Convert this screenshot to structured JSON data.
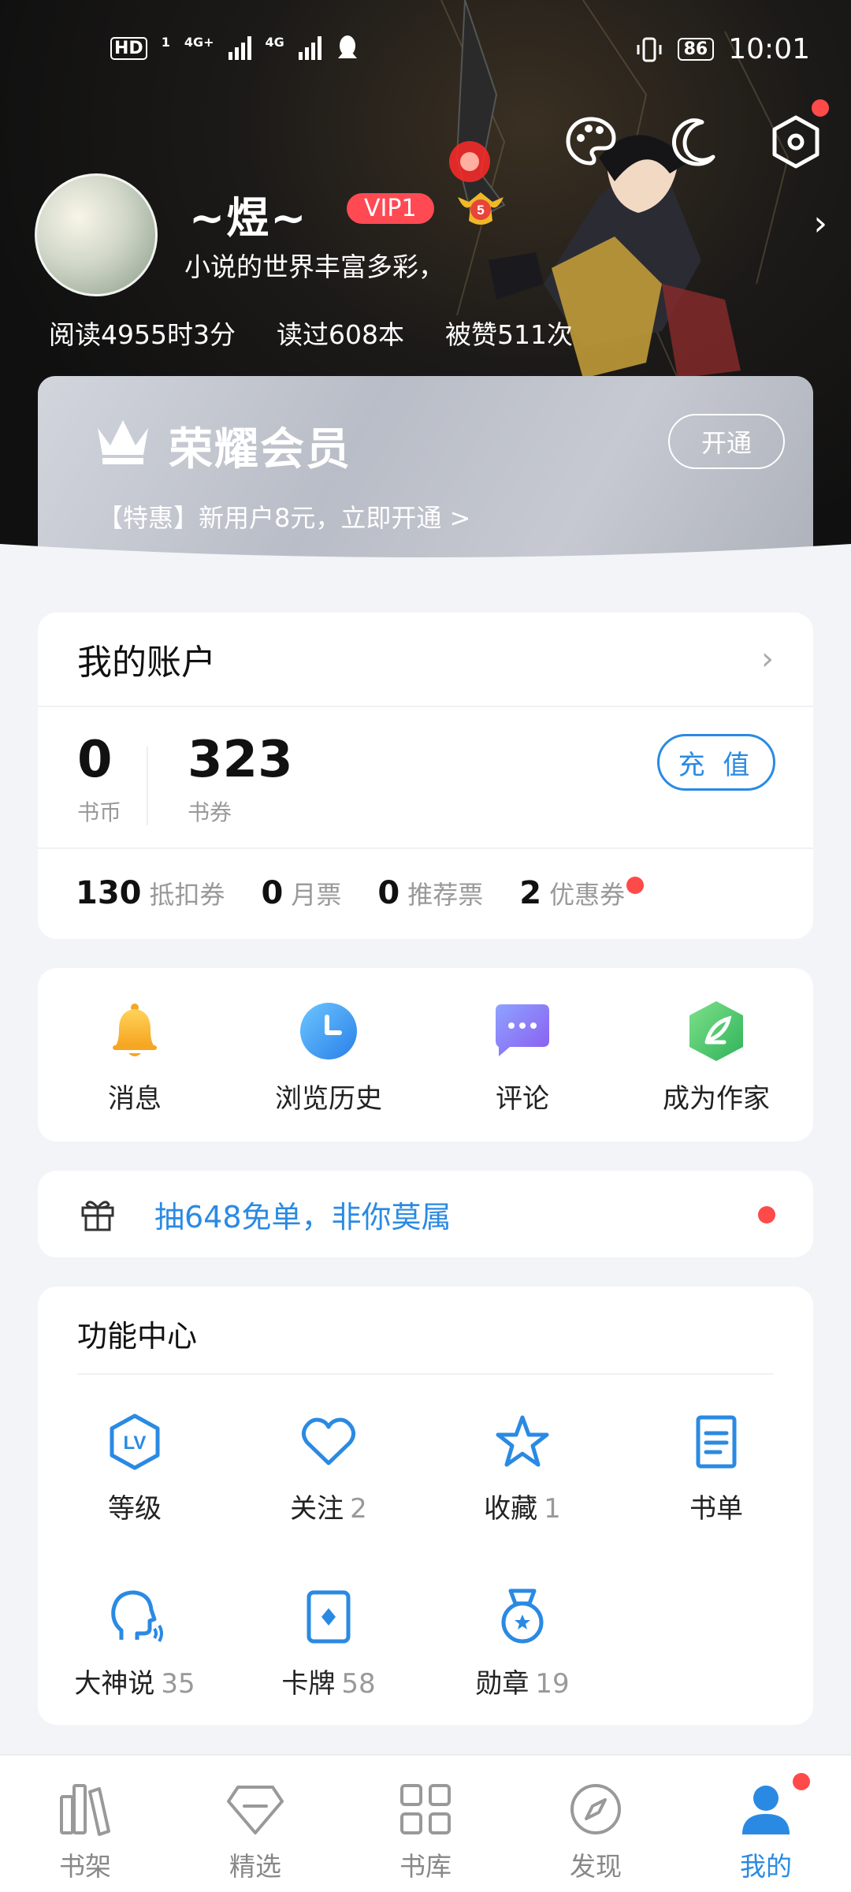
{
  "status_bar": {
    "hd": "HD",
    "sim1": "1",
    "net1": "4G+",
    "net2": "4G",
    "battery": "86",
    "time": "10:01"
  },
  "profile": {
    "username": "~煜~",
    "vip_badge": "VIP1",
    "level": "5",
    "bio": "小说的世界丰富多彩，",
    "stats": [
      "阅读4955时3分",
      "读过608本",
      "被赞511次"
    ]
  },
  "vip_card": {
    "title": "荣耀会员",
    "open_label": "开通",
    "promo": "【特惠】新用户8元，立即开通 >"
  },
  "account": {
    "title": "我的账户",
    "coins": {
      "value": "0",
      "label": "书币"
    },
    "vouchers": {
      "value": "323",
      "label": "书券"
    },
    "recharge_label": "充 值",
    "tickets": [
      {
        "value": "130",
        "label": "抵扣券"
      },
      {
        "value": "0",
        "label": "月票"
      },
      {
        "value": "0",
        "label": "推荐票"
      },
      {
        "value": "2",
        "label": "优惠券"
      }
    ]
  },
  "quick_actions": [
    {
      "label": "消息",
      "icon": "bell-icon"
    },
    {
      "label": "浏览历史",
      "icon": "clock-icon"
    },
    {
      "label": "评论",
      "icon": "chat-icon"
    },
    {
      "label": "成为作家",
      "icon": "feather-icon"
    }
  ],
  "promo_banner": {
    "text": "抽648免单，非你莫属"
  },
  "function_center": {
    "title": "功能中心",
    "items": [
      {
        "label": "等级",
        "count": "",
        "icon": "level-icon"
      },
      {
        "label": "关注",
        "count": "2",
        "icon": "heart-icon"
      },
      {
        "label": "收藏",
        "count": "1",
        "icon": "star-icon"
      },
      {
        "label": "书单",
        "count": "",
        "icon": "booklist-icon"
      },
      {
        "label": "大神说",
        "count": "35",
        "icon": "speaker-icon"
      },
      {
        "label": "卡牌",
        "count": "58",
        "icon": "card-icon"
      },
      {
        "label": "勋章",
        "count": "19",
        "icon": "medal-icon"
      }
    ]
  },
  "tabs": [
    {
      "label": "书架",
      "icon": "bookshelf-icon"
    },
    {
      "label": "精选",
      "icon": "diamond-icon"
    },
    {
      "label": "书库",
      "icon": "grid-icon"
    },
    {
      "label": "发现",
      "icon": "compass-icon"
    },
    {
      "label": "我的",
      "icon": "person-icon",
      "active": true
    }
  ],
  "colors": {
    "accent": "#2a8ae3",
    "vip_red": "#ff4a54",
    "dot_red": "#ff4a4a",
    "background": "#f3f4f8"
  }
}
